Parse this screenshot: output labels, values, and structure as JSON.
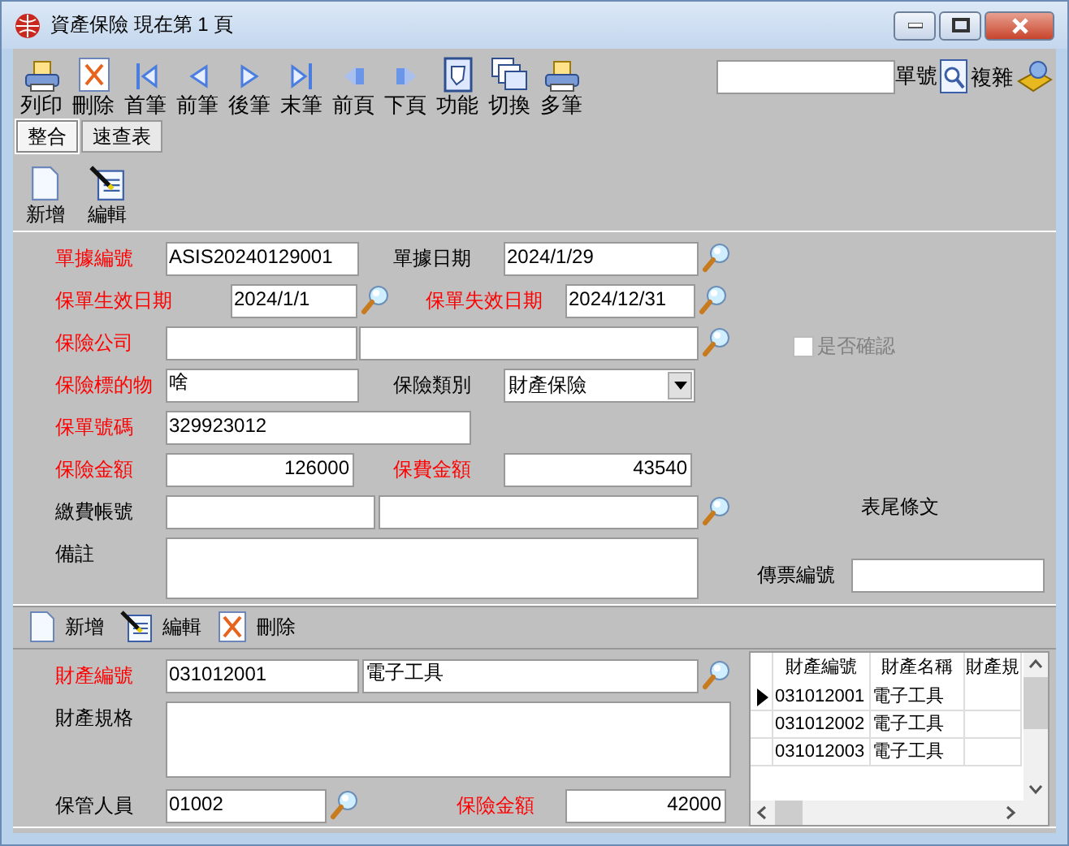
{
  "window": {
    "title": "資產保險  現在第 1 頁"
  },
  "toolbar": [
    {
      "kind": "print",
      "label": "列印"
    },
    {
      "kind": "delete",
      "label": "刪除"
    },
    {
      "kind": "first",
      "label": "首筆"
    },
    {
      "kind": "prev",
      "label": "前筆"
    },
    {
      "kind": "next",
      "label": "後筆"
    },
    {
      "kind": "last",
      "label": "末筆"
    },
    {
      "kind": "prev_page",
      "label": "前頁"
    },
    {
      "kind": "next_page",
      "label": "下頁"
    },
    {
      "kind": "function",
      "label": "功能"
    },
    {
      "kind": "switch",
      "label": "切換"
    },
    {
      "kind": "multi",
      "label": "多筆"
    }
  ],
  "lookup": {
    "label": "單號",
    "button": "複雜"
  },
  "tabs": [
    {
      "label": "整合",
      "selected": true
    },
    {
      "label": "速查表",
      "selected": false
    }
  ],
  "actions": [
    {
      "kind": "new",
      "label": "新增"
    },
    {
      "kind": "edit",
      "label": "編輯"
    }
  ],
  "form": {
    "doc_no": {
      "label": "單據編號",
      "required": true,
      "value": "ASIS20240129001"
    },
    "doc_date": {
      "label": "單據日期",
      "required": false,
      "value": "2024/1/29"
    },
    "start_date": {
      "label": "保單生效日期",
      "required": true,
      "value": "2024/1/1"
    },
    "end_date": {
      "label": "保單失效日期",
      "required": true,
      "value": "2024/12/31"
    },
    "insurer": {
      "label": "保險公司",
      "required": true
    },
    "subject": {
      "label": "保險標的物",
      "required": true,
      "value": "啥"
    },
    "category": {
      "label": "保險類別",
      "required": false,
      "value": "財產保險"
    },
    "policy_no": {
      "label": "保單號碼",
      "required": true,
      "value": "329923012"
    },
    "insured_amount": {
      "label": "保險金額",
      "required": true,
      "value": "126000"
    },
    "premium": {
      "label": "保費金額",
      "required": true,
      "value": "43540"
    },
    "account": {
      "label": "繳費帳號",
      "required": false
    },
    "remarks": {
      "label": "備註",
      "required": false
    },
    "confirmed": {
      "label": "是否確認",
      "checked": false,
      "disabled": true
    },
    "footer_terms": {
      "label": "表尾條文"
    },
    "voucher_no": {
      "label": "傳票編號"
    }
  },
  "detail_actions": [
    {
      "kind": "new",
      "label": "新增"
    },
    {
      "kind": "edit",
      "label": "編輯"
    },
    {
      "kind": "delete",
      "label": "刪除"
    }
  ],
  "detail": {
    "asset_no": {
      "label": "財產編號",
      "required": true,
      "value": "031012001",
      "name": "電子工具"
    },
    "spec": {
      "label": "財產規格",
      "required": false
    },
    "custodian": {
      "label": "保管人員",
      "required": false,
      "value": "01002"
    },
    "amount": {
      "label": "保險金額",
      "required": true,
      "value": "42000"
    }
  },
  "grid": {
    "columns": [
      "財產編號",
      "財產名稱",
      "財產規"
    ],
    "rows": [
      {
        "selected": true,
        "cells": [
          "031012001",
          "電子工具"
        ]
      },
      {
        "selected": false,
        "cells": [
          "031012002",
          "電子工具"
        ]
      },
      {
        "selected": false,
        "cells": [
          "031012003",
          "電子工具"
        ]
      }
    ]
  }
}
